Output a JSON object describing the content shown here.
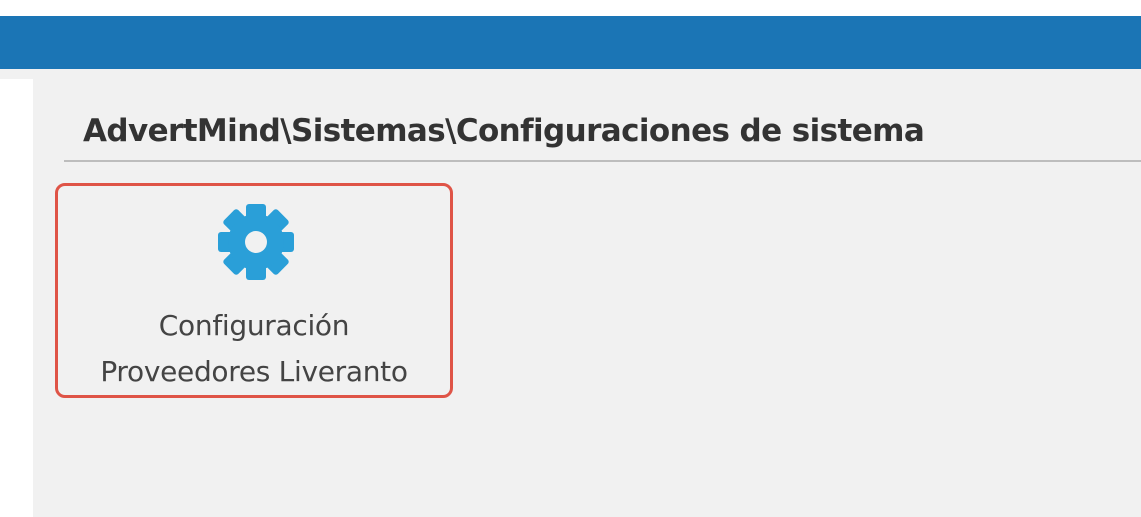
{
  "breadcrumb": {
    "path": "AdvertMind\\Sistemas\\Configuraciones de sistema"
  },
  "tiles": [
    {
      "icon": "gear-icon",
      "label_line1": "Configuración",
      "label_line2": "Proveedores Liveranto"
    }
  ],
  "colors": {
    "header": "#1b75b5",
    "icon": "#2a9fd8",
    "tile_border": "#df5447"
  }
}
